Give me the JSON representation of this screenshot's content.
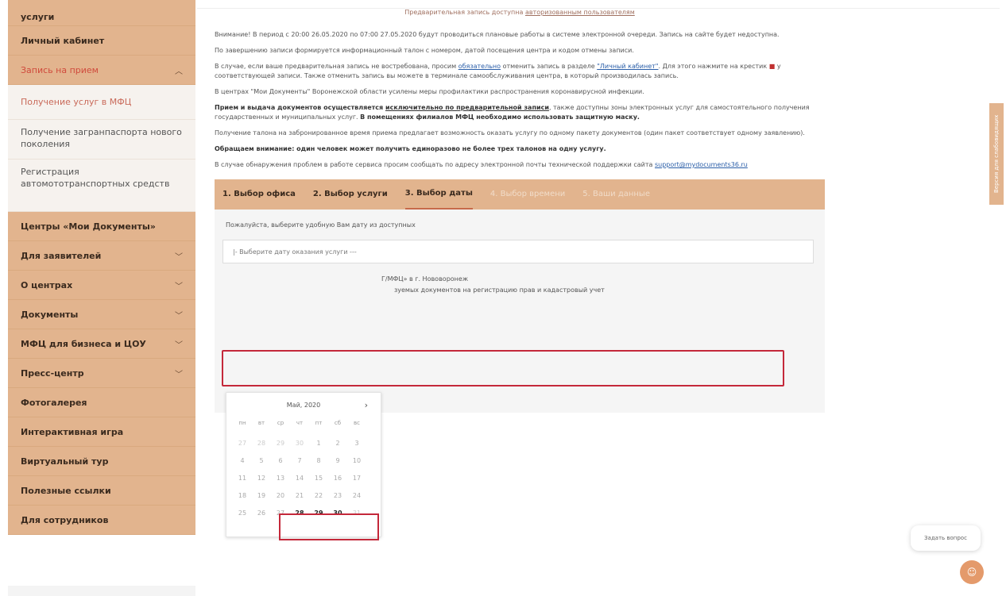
{
  "sidebar": {
    "top_item": "услуги",
    "items_a": [
      {
        "label": "Личный кабинет"
      },
      {
        "label": "Запись на прием"
      }
    ],
    "sub_items": [
      {
        "label": "Получение услуг в МФЦ"
      },
      {
        "label": "Получение загранпаспорта нового поколения"
      },
      {
        "label": "Регистрация автомототранспортных средств"
      }
    ],
    "items_b": [
      {
        "label": "Центры «Мои Документы»"
      },
      {
        "label": "Для заявителей"
      },
      {
        "label": "О центрах"
      },
      {
        "label": "Документы"
      },
      {
        "label": "МФЦ для бизнеса и ЦОУ"
      },
      {
        "label": "Пресс-центр"
      },
      {
        "label": "Фотогалерея"
      },
      {
        "label": "Интерактивная игра"
      },
      {
        "label": "Виртуальный тур"
      },
      {
        "label": "Полезные ссылки"
      },
      {
        "label": "Для сотрудников"
      }
    ]
  },
  "main": {
    "top_notice_text": "Предварительная запись доступна ",
    "top_notice_link": "авторизованным пользователям",
    "p1": "Внимание! В период с 20:00 26.05.2020 по 07:00 27.05.2020 будут проводиться плановые работы в системе электронной очереди. Запись на сайте будет недоступна.",
    "p2": "По завершению записи формируется информационный талон с номером, датой посещения центра и кодом отмены записи.",
    "p3_a": "В случае, если ваше предварительная запись не востребована, просим ",
    "p3_link1": "обязательно",
    "p3_b": " отменить запись в разделе ",
    "p3_link2": "\"Личный кабинет\"",
    "p3_c": ". Для этого нажмите на крестик ",
    "p3_mark": "■",
    "p3_d": " у соответствующей записи. Также отменить запись вы можете в терминале самообслуживания центра, в который производилась запись.",
    "p4": "В центрах \"Мои Документы\" Воронежской области усилены меры профилактики распространения коронавирусной инфекции.",
    "p5_a": "Прием и выдача документов осуществляется ",
    "p5_u": "исключительно по предварительной записи",
    "p5_b": ", также доступны зоны электронных услуг для самостоятельного получения государственных и муниципальных услуг. ",
    "p5_c": "В помещениях филиалов МФЦ необходимо использовать защитную маску.",
    "p6": "Получение талона на забронированное время приема предлагает возможность оказать услугу по одному пакету документов (один пакет соответствует одному заявлению).",
    "p7": "Обращаем внимание: один человек может получить единоразово не более трех талонов на одну услугу.",
    "p8_a": "В случае обнаружения проблем в работе сервиса просим сообщать по адресу электронной почты технической поддержки сайта ",
    "p8_link": "support@mydocuments36.ru"
  },
  "steps": [
    {
      "label": "1. Выбор офиса",
      "state": "done"
    },
    {
      "label": "2. Выбор услуги",
      "state": "done"
    },
    {
      "label": "3. Выбор даты",
      "state": "active"
    },
    {
      "label": "4. Выбор времени",
      "state": "disabled"
    },
    {
      "label": "5. Ваши данные",
      "state": "disabled"
    }
  ],
  "form": {
    "label": "Пожалуйста, выберите удобную Вам дату из доступных",
    "select_value": "|- Выберите дату оказания услуги ---",
    "office_info": "Г/МФЦ» в г. Нововоронеж",
    "service_info": "зуемых документов на регистрацию прав и кадастровый учет"
  },
  "calendar": {
    "month": "Май",
    "year": "2020",
    "next_icon": "chevron-right-icon",
    "weekdays": [
      "пн",
      "вт",
      "ср",
      "чт",
      "пт",
      "сб",
      "вс"
    ],
    "days": [
      {
        "d": "27",
        "s": "faded"
      },
      {
        "d": "28",
        "s": "faded"
      },
      {
        "d": "29",
        "s": "faded"
      },
      {
        "d": "30",
        "s": "faded"
      },
      {
        "d": "1",
        "s": "x"
      },
      {
        "d": "2",
        "s": "x"
      },
      {
        "d": "3",
        "s": "x"
      },
      {
        "d": "4",
        "s": "x"
      },
      {
        "d": "5",
        "s": "x"
      },
      {
        "d": "6",
        "s": "x"
      },
      {
        "d": "7",
        "s": "x"
      },
      {
        "d": "8",
        "s": "x"
      },
      {
        "d": "9",
        "s": "x"
      },
      {
        "d": "10",
        "s": "x"
      },
      {
        "d": "11",
        "s": "x"
      },
      {
        "d": "12",
        "s": "x"
      },
      {
        "d": "13",
        "s": "x"
      },
      {
        "d": "14",
        "s": "x"
      },
      {
        "d": "15",
        "s": "x"
      },
      {
        "d": "16",
        "s": "x"
      },
      {
        "d": "17",
        "s": "x"
      },
      {
        "d": "18",
        "s": "x"
      },
      {
        "d": "19",
        "s": "x"
      },
      {
        "d": "20",
        "s": "x"
      },
      {
        "d": "21",
        "s": "x"
      },
      {
        "d": "22",
        "s": "x"
      },
      {
        "d": "23",
        "s": "x"
      },
      {
        "d": "24",
        "s": "x"
      },
      {
        "d": "25",
        "s": "x"
      },
      {
        "d": "26",
        "s": "x"
      },
      {
        "d": "27",
        "s": "x"
      },
      {
        "d": "28",
        "s": "avail"
      },
      {
        "d": "29",
        "s": "avail"
      },
      {
        "d": "30",
        "s": "avail"
      },
      {
        "d": "31",
        "s": "faded"
      }
    ]
  },
  "widgets": {
    "side_tab": "Версия для слабовидящих",
    "ask_label": "Задать вопрос",
    "ask_icon": "chat-icon"
  },
  "colors": {
    "brand": "#e2b48e",
    "highlight": "#c4283a",
    "link": "#2a5ea8"
  }
}
